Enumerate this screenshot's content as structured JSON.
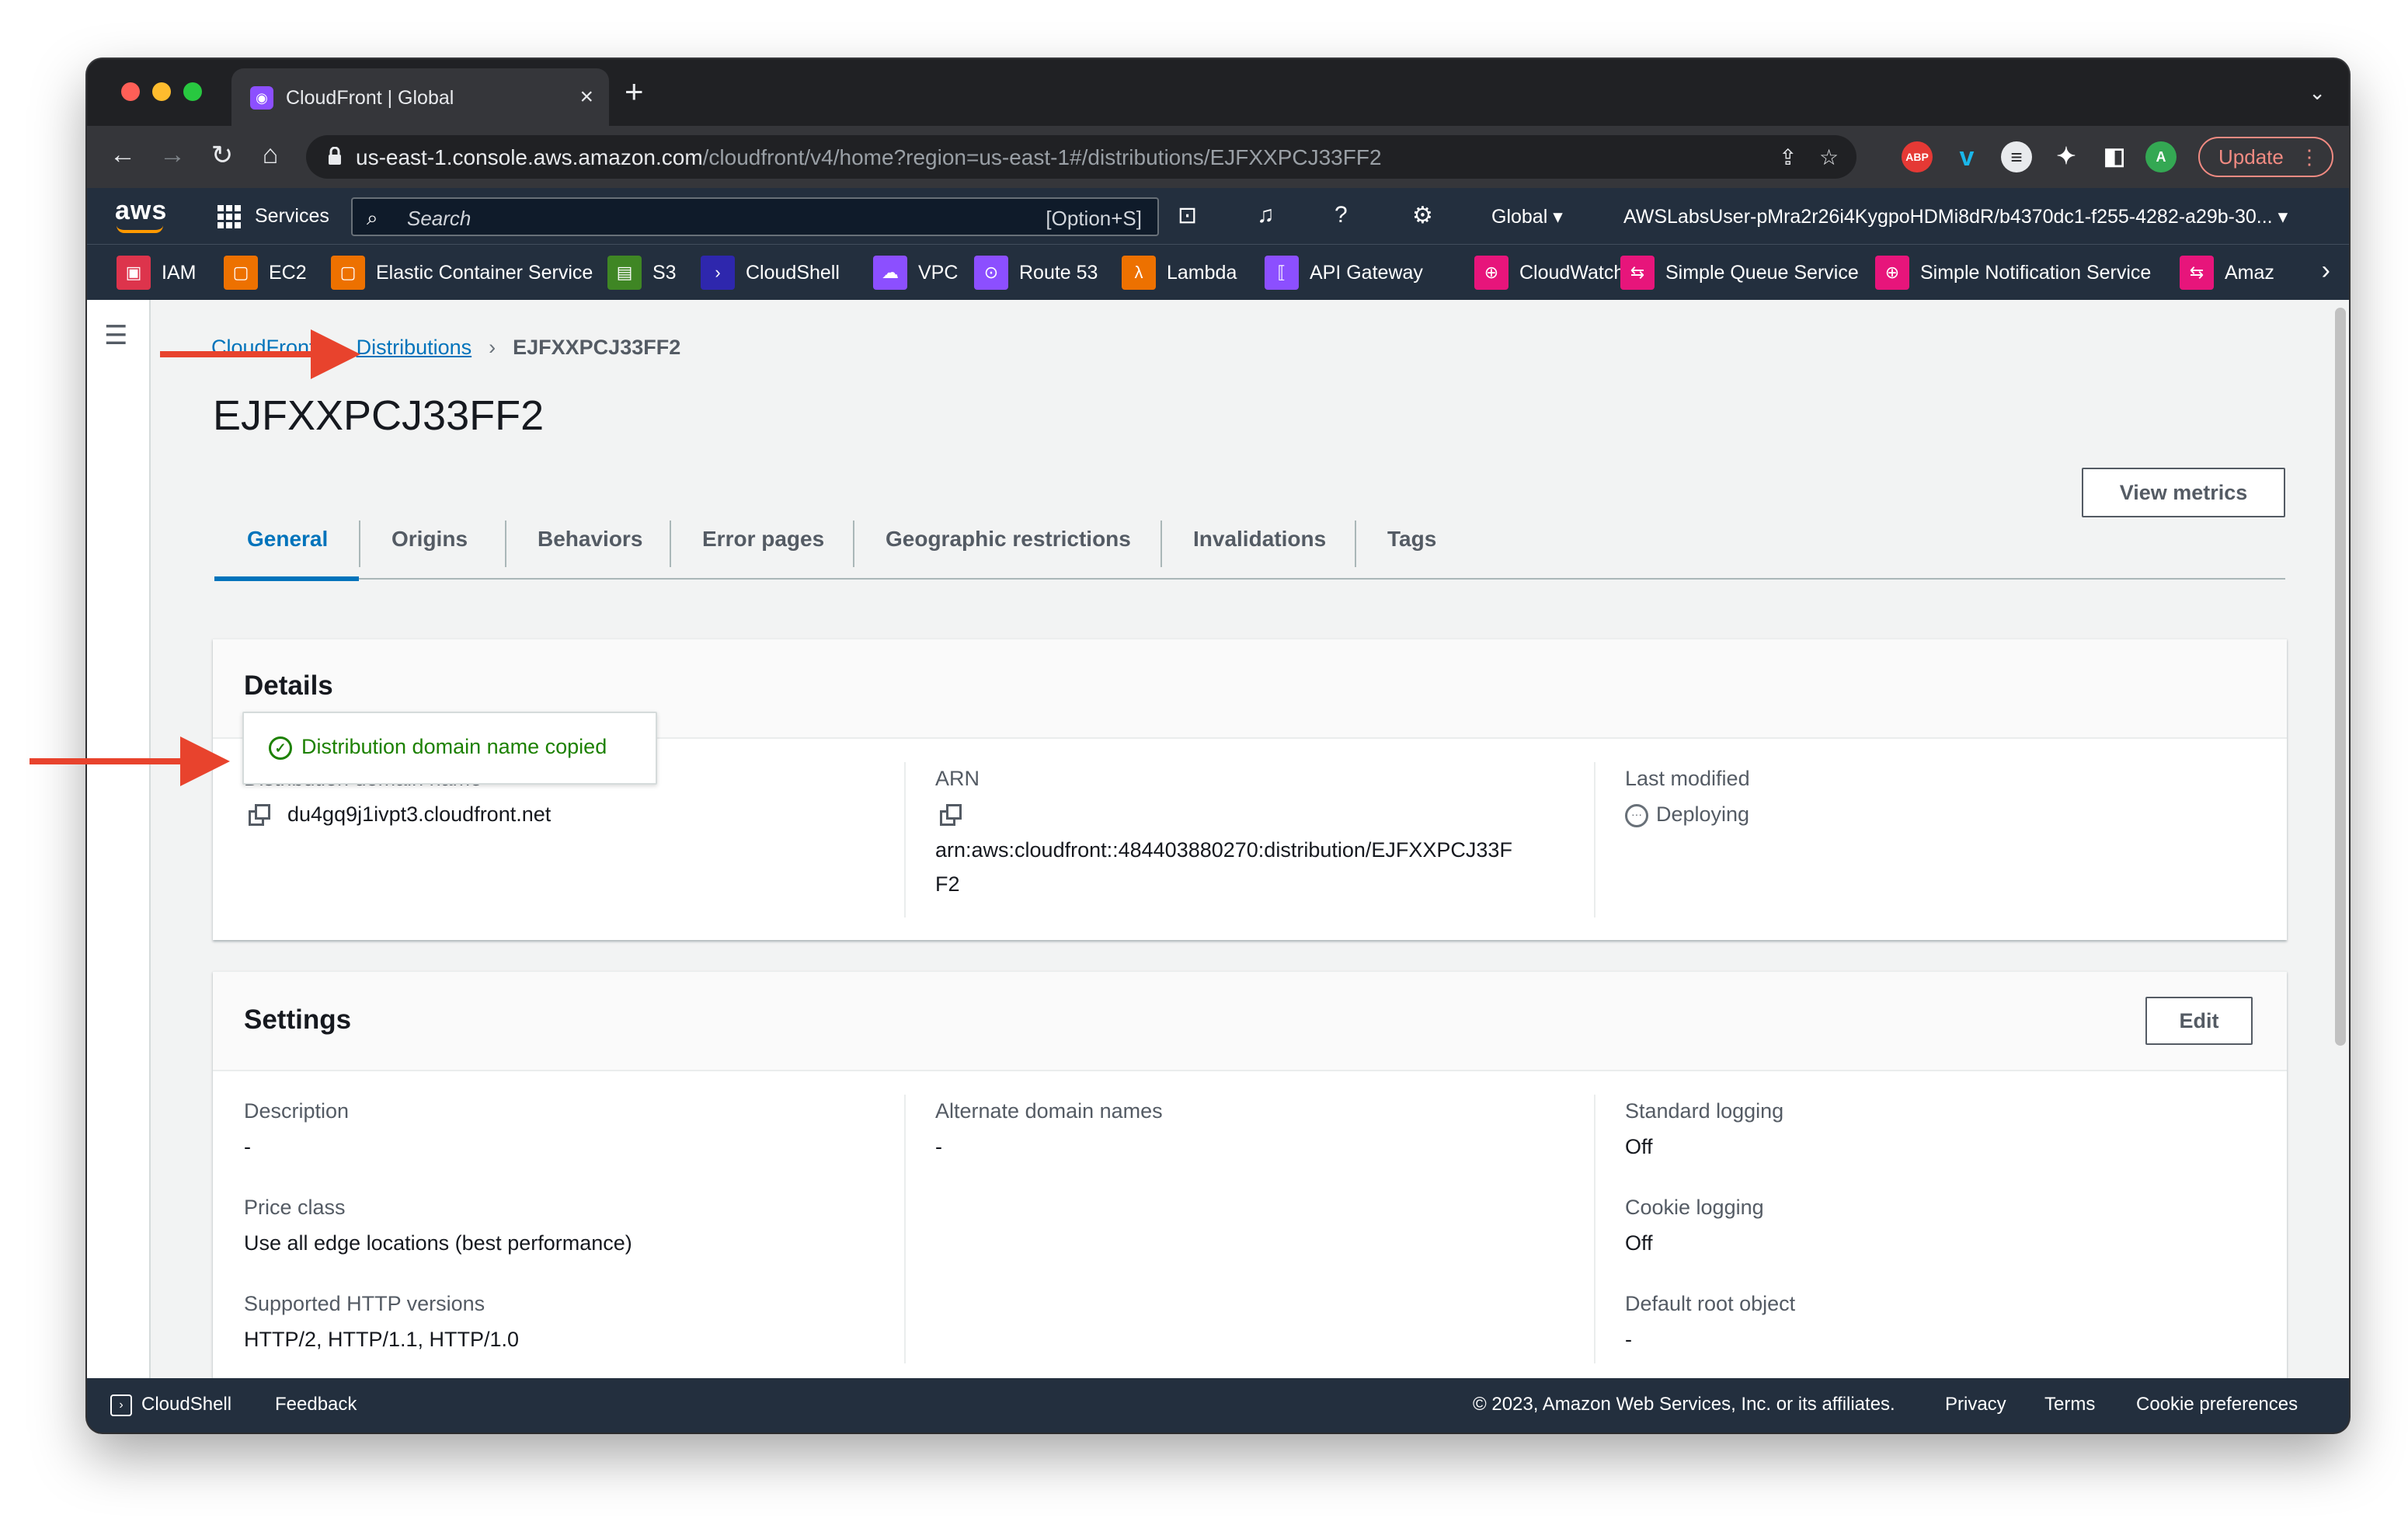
{
  "browser": {
    "tab_title": "CloudFront | Global",
    "url_host": "us-east-1.console.aws.amazon.com",
    "url_path": "/cloudfront/v4/home?region=us-east-1#/distributions/EJFXXPCJ33FF2",
    "update_label": "Update",
    "avatar_letter": "A",
    "ext_abp": "ABP"
  },
  "aws_nav": {
    "logo": "aws",
    "services": "Services",
    "search_placeholder": "Search",
    "search_shortcut": "[Option+S]",
    "region": "Global",
    "account": "AWSLabsUser-pMra2r26i4KygpoHDMi8dR/b4370dc1-f255-4282-a29b-30..."
  },
  "favorites": [
    {
      "label": "IAM",
      "color": "#dd344c"
    },
    {
      "label": "EC2",
      "color": "#ed7100"
    },
    {
      "label": "Elastic Container Service",
      "color": "#ed7100"
    },
    {
      "label": "S3",
      "color": "#3f8624"
    },
    {
      "label": "CloudShell",
      "color": "#2e27ad"
    },
    {
      "label": "VPC",
      "color": "#8c4fff"
    },
    {
      "label": "Route 53",
      "color": "#8c4fff"
    },
    {
      "label": "Lambda",
      "color": "#ed7100"
    },
    {
      "label": "API Gateway",
      "color": "#8c4fff"
    },
    {
      "label": "CloudWatch",
      "color": "#e7157b"
    },
    {
      "label": "Simple Queue Service",
      "color": "#e7157b"
    },
    {
      "label": "Simple Notification Service",
      "color": "#e7157b"
    },
    {
      "label": "Amaz",
      "color": "#e7157b"
    }
  ],
  "breadcrumb": {
    "root": "CloudFront",
    "parent": "Distributions",
    "current": "EJFXXPCJ33FF2"
  },
  "page": {
    "title": "EJFXXPCJ33FF2",
    "view_metrics": "View metrics"
  },
  "tabs": [
    "General",
    "Origins",
    "Behaviors",
    "Error pages",
    "Geographic restrictions",
    "Invalidations",
    "Tags"
  ],
  "details": {
    "title": "Details",
    "tooltip": "Distribution domain name copied",
    "domain_label": "Distribution domain name",
    "domain_value": "du4gq9j1ivpt3.cloudfront.net",
    "arn_label": "ARN",
    "arn_line1": "arn:aws:cloudfront::484403880270:distribution/EJFXXPCJ33F",
    "arn_line2": "F2",
    "last_modified_label": "Last modified",
    "last_modified_value": "Deploying"
  },
  "settings": {
    "title": "Settings",
    "edit": "Edit",
    "description_label": "Description",
    "description_value": "-",
    "price_class_label": "Price class",
    "price_class_value": "Use all edge locations (best performance)",
    "http_versions_label": "Supported HTTP versions",
    "http_versions_value": "HTTP/2, HTTP/1.1, HTTP/1.0",
    "alt_domains_label": "Alternate domain names",
    "alt_domains_value": "-",
    "std_logging_label": "Standard logging",
    "std_logging_value": "Off",
    "cookie_logging_label": "Cookie logging",
    "cookie_logging_value": "Off",
    "default_root_label": "Default root object",
    "default_root_value": "-"
  },
  "footer": {
    "cloudshell": "CloudShell",
    "feedback": "Feedback",
    "copyright": "© 2023, Amazon Web Services, Inc. or its affiliates.",
    "privacy": "Privacy",
    "terms": "Terms",
    "cookie_prefs": "Cookie preferences"
  },
  "colors": {
    "annotation_arrow": "#e8432d",
    "link": "#0073bb",
    "success": "#1d8102",
    "aws_nav": "#232f3e"
  }
}
